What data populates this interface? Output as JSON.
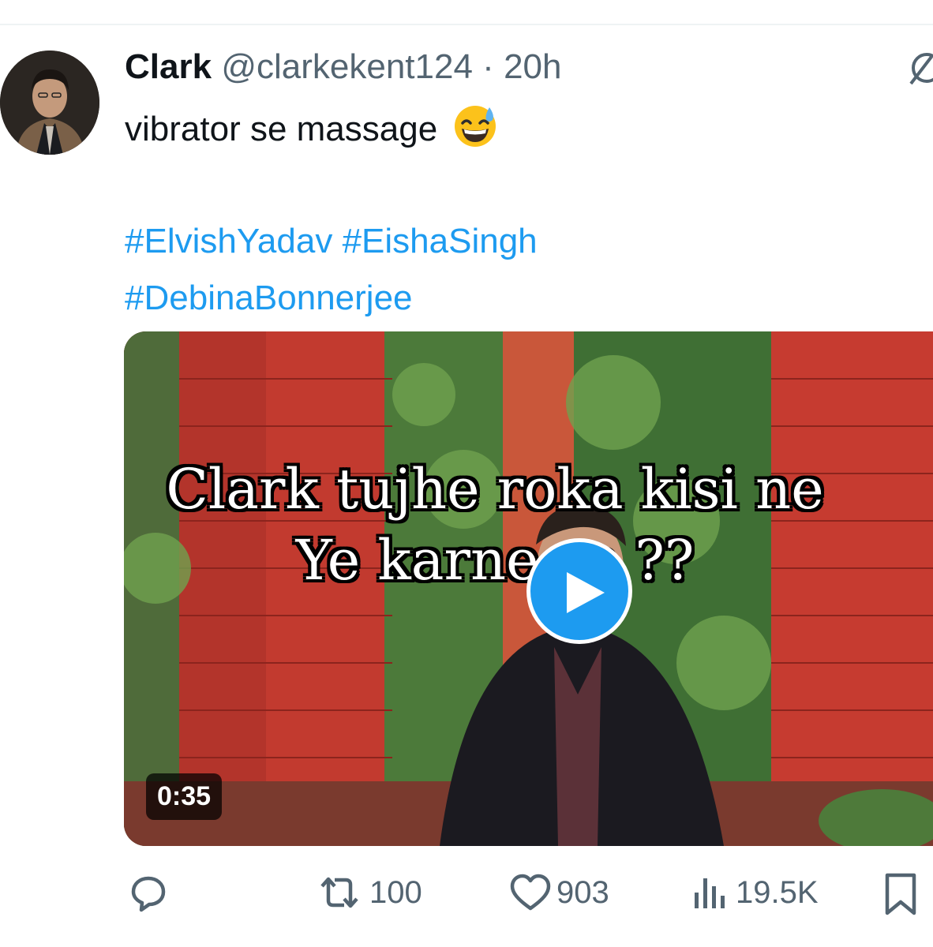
{
  "tweet": {
    "display_name": "Clark",
    "handle": "@clarkekent124",
    "separator": "·",
    "time": "20h",
    "text": "vibrator se massage",
    "emoji": "grinning-face-with-sweat",
    "hashtags": [
      "#ElvishYadav",
      "#EishaSingh",
      "#DebinaBonnerjee"
    ]
  },
  "media": {
    "caption_line1": "Clark tujhe roka kisi ne",
    "caption_line2": "Ye karne se ??",
    "duration": "0:35"
  },
  "actions": {
    "replies": "",
    "retweets": "100",
    "likes": "903",
    "views": "19.5K"
  },
  "colors": {
    "accent": "#1d9bf0",
    "muted_text": "#536471",
    "primary_text": "#0f1419"
  }
}
